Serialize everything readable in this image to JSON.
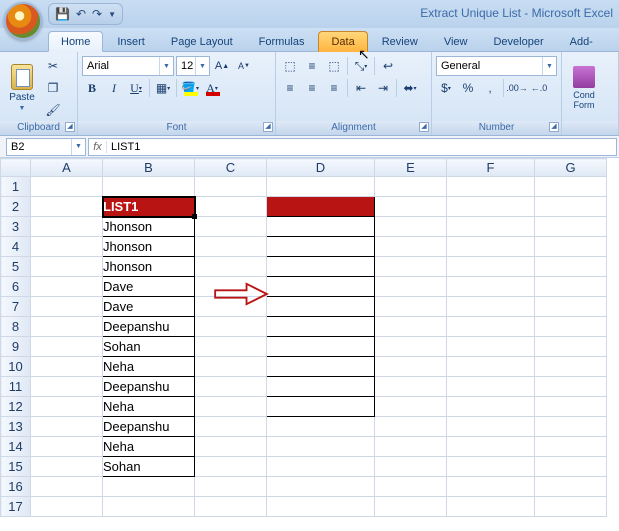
{
  "app": {
    "title": "Extract Unique List - Microsoft Excel"
  },
  "qat": {
    "items": [
      "save-icon",
      "undo-icon",
      "redo-icon"
    ]
  },
  "tabs": {
    "items": [
      {
        "id": "home",
        "label": "Home",
        "state": "active"
      },
      {
        "id": "insert",
        "label": "Insert",
        "state": ""
      },
      {
        "id": "pagelayout",
        "label": "Page Layout",
        "state": ""
      },
      {
        "id": "formulas",
        "label": "Formulas",
        "state": ""
      },
      {
        "id": "data",
        "label": "Data",
        "state": "hover"
      },
      {
        "id": "review",
        "label": "Review",
        "state": ""
      },
      {
        "id": "view",
        "label": "View",
        "state": ""
      },
      {
        "id": "developer",
        "label": "Developer",
        "state": ""
      },
      {
        "id": "addins",
        "label": "Add-",
        "state": ""
      }
    ]
  },
  "ribbon": {
    "clipboard": {
      "title": "Clipboard",
      "paste": "Paste"
    },
    "font": {
      "title": "Font",
      "name": "Arial",
      "size": "12",
      "fill": "#ffff00",
      "color": "#d40000"
    },
    "alignment": {
      "title": "Alignment"
    },
    "number": {
      "title": "Number",
      "format": "General"
    },
    "condfmt": {
      "label": "Cond\nForm"
    }
  },
  "namebox": {
    "ref": "B2"
  },
  "formulabar": {
    "value": "LIST1"
  },
  "columns": [
    "A",
    "B",
    "C",
    "D",
    "E",
    "F",
    "G"
  ],
  "rows": [
    1,
    2,
    3,
    4,
    5,
    6,
    7,
    8,
    9,
    10,
    11,
    12,
    13,
    14,
    15,
    16,
    17
  ],
  "list_header": "LIST1",
  "list": [
    "Jhonson",
    "Jhonson",
    "Jhonson",
    "Dave",
    "Dave",
    "Deepanshu",
    "Sohan",
    "Neha",
    "Deepanshu",
    "Neha",
    "Deepanshu",
    "Neha",
    "Sohan"
  ],
  "colors": {
    "accent": "#3c6aa8",
    "list_header_bg": "#b91414"
  }
}
